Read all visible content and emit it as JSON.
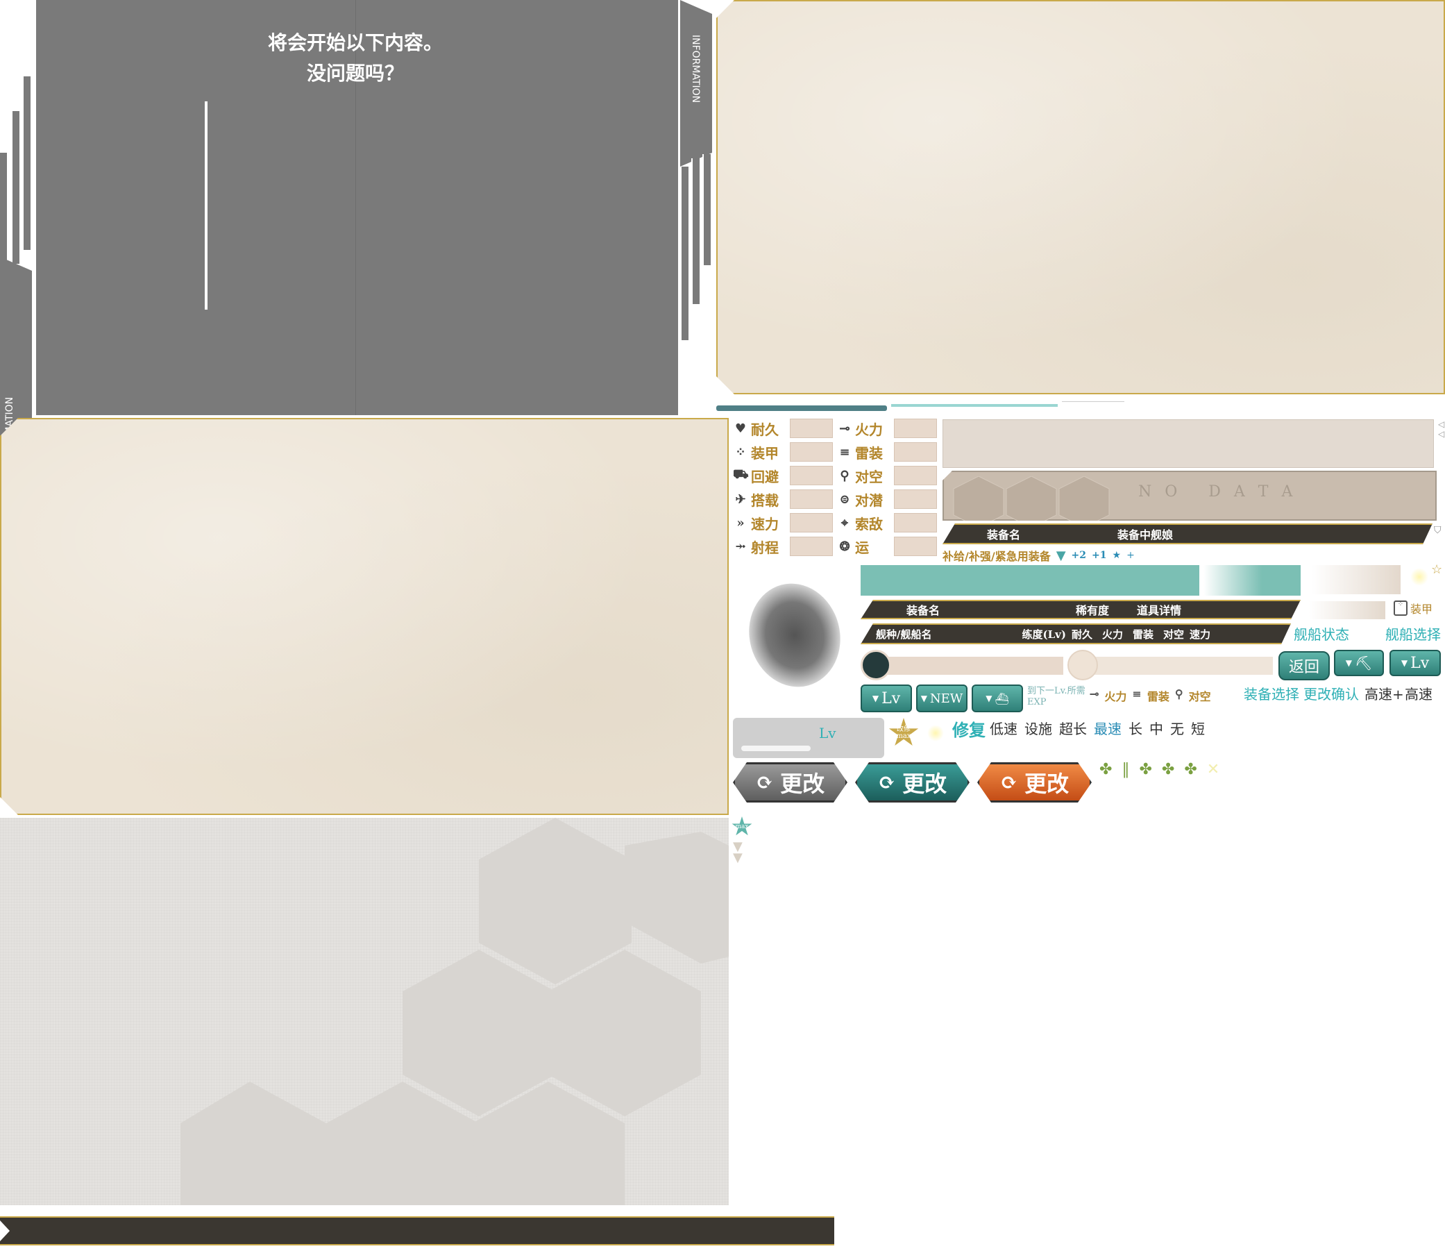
{
  "dialog": {
    "line1": "将会开始以下内容。",
    "line2": "没问题吗？",
    "tab_left": "INFORMATION",
    "tab_right": "INFORMATION"
  },
  "stats": {
    "left": [
      {
        "label": "耐久",
        "icon": "heart-icon"
      },
      {
        "label": "装甲",
        "icon": "armor-icon"
      },
      {
        "label": "回避",
        "icon": "evasion-icon"
      },
      {
        "label": "搭载",
        "icon": "plane-icon"
      },
      {
        "label": "速力",
        "icon": "speed-icon"
      },
      {
        "label": "射程",
        "icon": "range-icon"
      }
    ],
    "right": [
      {
        "label": "火力",
        "icon": "gun-icon"
      },
      {
        "label": "雷装",
        "icon": "torpedo-icon"
      },
      {
        "label": "对空",
        "icon": "aa-icon"
      },
      {
        "label": "对潜",
        "icon": "asw-icon"
      },
      {
        "label": "索敌",
        "icon": "los-icon"
      },
      {
        "label": "运",
        "icon": "luck-icon"
      }
    ]
  },
  "no_data": "N O   D A T A",
  "equip_header": {
    "col1": "装备名",
    "col2": "装备中舰娘"
  },
  "supply_line": "补给/补强/紧急用装备",
  "plus_marks": [
    "+2",
    "+1",
    "★",
    "+"
  ],
  "equip_header2": {
    "col1": "装备名",
    "col2": "稀有度",
    "col3": "道具详情"
  },
  "armor_small": "装甲",
  "ship_header": {
    "col1": "舰种/舰船名",
    "col2": "练度(Lv)",
    "col3": "耐久",
    "col4": "火力",
    "col5": "雷装",
    "col6": "对空",
    "col7": "速力"
  },
  "ship_status": "舰船状态",
  "ship_select": "舰船选择",
  "back_btn": "返回",
  "lv_btn": "Lv",
  "lv_btn2": "Lv",
  "new_btn": "NEW",
  "next_exp": "到下一Lv.所需EXP",
  "mini_stats": [
    "火力",
    "雷装",
    "对空"
  ],
  "equip_select": "装备选择",
  "modify_confirm": "更改确认",
  "speed_fast_plus": "高速+",
  "speed_fast": "高速",
  "lv_label": "Lv",
  "max_badge": "改修max",
  "repair": "修复",
  "speed_low": "低速",
  "facility": "设施",
  "range_super": "超长",
  "speed_max": "最速",
  "range_long": "长",
  "range_mid": "中",
  "range_none": "无",
  "range_short": "短",
  "change_label": "更改",
  "max_small": "max",
  "colors": {
    "teal": "#2fb0b5",
    "gold": "#c9a94a",
    "panel": "#ece3d4",
    "gray": "#7a7a7a",
    "dark": "#3b3731",
    "orange": "#e06a28"
  }
}
